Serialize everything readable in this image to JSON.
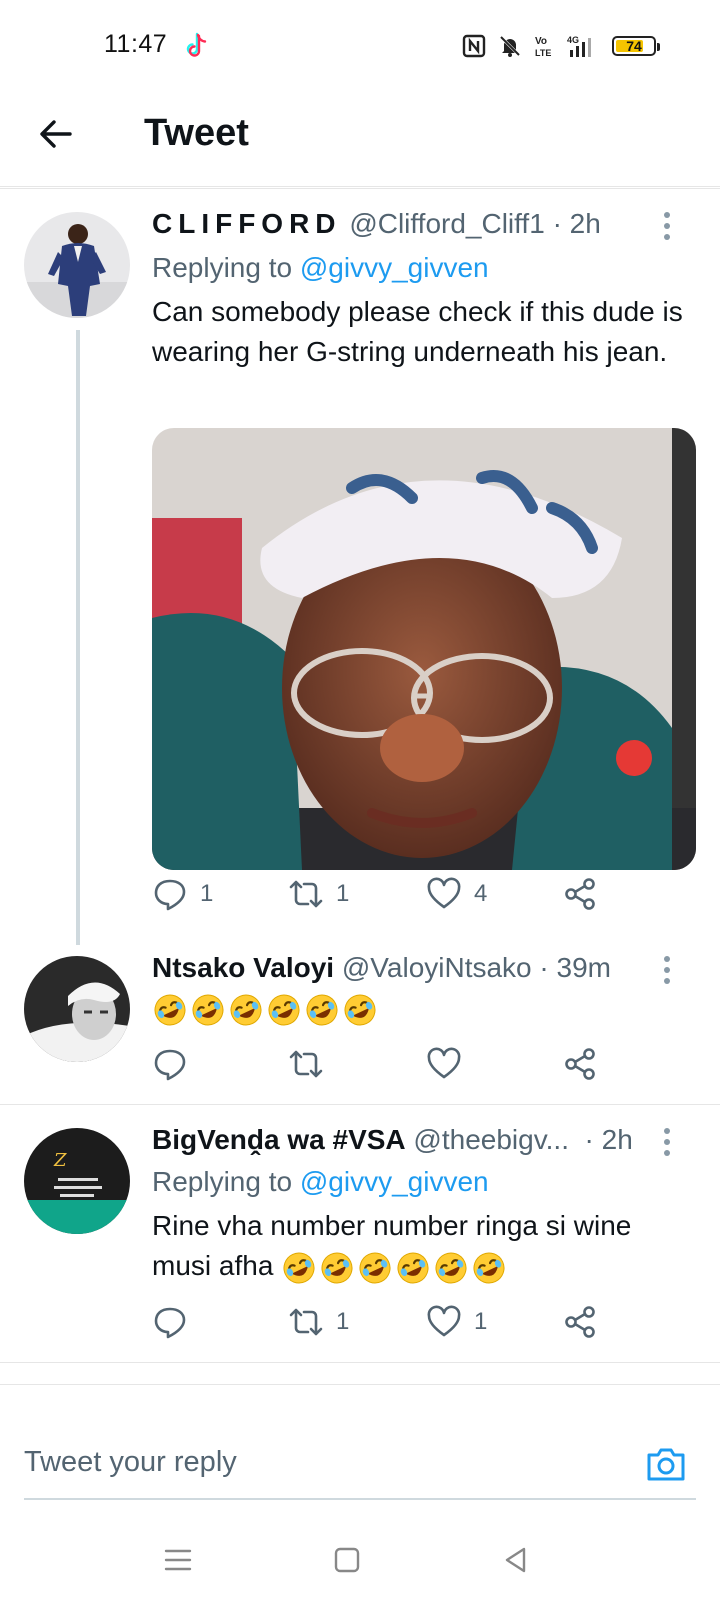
{
  "status_bar": {
    "time": "11:47",
    "battery": "74",
    "battery_level": 0.74,
    "icons": [
      "tiktok-icon",
      "nfc-icon",
      "mute-icon",
      "volte-icon",
      "4g-signal-icon",
      "battery-icon"
    ]
  },
  "header": {
    "title": "Tweet"
  },
  "tweets": [
    {
      "name": "CLIFFORD",
      "handle": "@Clifford_Cliff1",
      "time": "· 2h",
      "replying_prefix": "Replying to",
      "replying_to": "@givvy_givven",
      "text": "Can somebody please check if this dude is wearing her G-string underneath his jean.",
      "counts": {
        "reply": "1",
        "retweet": "1",
        "like": "4"
      }
    },
    {
      "name": "Ntsako Valoyi",
      "handle": "@ValoyiNtsako",
      "time": "· 39m",
      "emoji_count": 6
    },
    {
      "name": "BigVenḓa wa #VSA",
      "handle": "@theebigv...",
      "time": "· 2h",
      "replying_prefix": "Replying to",
      "replying_to": "@givvy_givven",
      "text": "Rine vha number number ringa si wine musi afha",
      "emoji_count": 6,
      "counts": {
        "reply": "",
        "retweet": "1",
        "like": "1"
      }
    }
  ],
  "reply_box": {
    "placeholder": "Tweet your reply"
  },
  "colors": {
    "link": "#1d9bf0",
    "secondary_text": "#536471",
    "thread_line": "#cfd9de",
    "battery": "#f5c400"
  }
}
